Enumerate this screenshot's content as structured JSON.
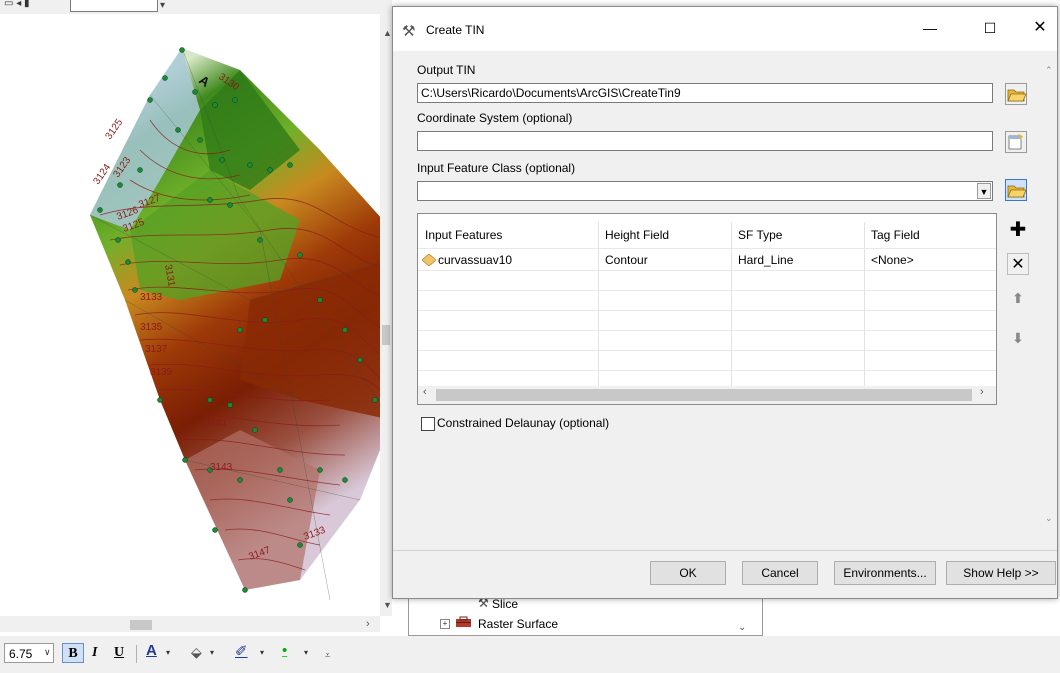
{
  "dialog": {
    "title": "Create TIN",
    "output_tin": {
      "label": "Output TIN",
      "value": "C:\\Users\\Ricardo\\Documents\\ArcGIS\\CreateTin9"
    },
    "coordinate_system": {
      "label": "Coordinate System (optional)",
      "value": ""
    },
    "input_feature_class": {
      "label": "Input Feature Class (optional)",
      "value": ""
    },
    "table": {
      "columns": [
        "Input Features",
        "Height Field",
        "SF Type",
        "Tag Field"
      ],
      "rows": [
        {
          "features": "curvassuav10",
          "height": "Contour",
          "sf_type": "Hard_Line",
          "tag": "<None>"
        }
      ]
    },
    "constrained_delaunay": {
      "label": "Constrained Delaunay (optional)",
      "checked": false
    },
    "buttons": {
      "ok": "OK",
      "cancel": "Cancel",
      "environments": "Environments...",
      "show_help": "Show Help >>"
    }
  },
  "catalog_tree": {
    "items": [
      {
        "label": "Slice"
      },
      {
        "label": "Raster Surface"
      }
    ]
  },
  "text_toolbar": {
    "font_size": "6.75",
    "bold": "B",
    "italic": "I",
    "underline": "U",
    "font_color": "A"
  },
  "map": {
    "contour_labels": [
      "3130",
      "3125",
      "3124",
      "3123",
      "3127",
      "3126",
      "3125",
      "3131",
      "3133",
      "3135",
      "3137",
      "3139",
      "3141",
      "3143",
      "3147",
      "3133"
    ],
    "colors": {
      "low": "#8a1f05",
      "mid": "#4a9a1a",
      "high": "#7aa6b8",
      "contour": "#8b1a1a",
      "points": "#1a8a3a"
    }
  },
  "colors": {
    "dialog_bg": "#f0f0f0",
    "title_bg": "#ffffff",
    "button_bg": "#e1e1e1",
    "selection": "#cfe0f7"
  }
}
